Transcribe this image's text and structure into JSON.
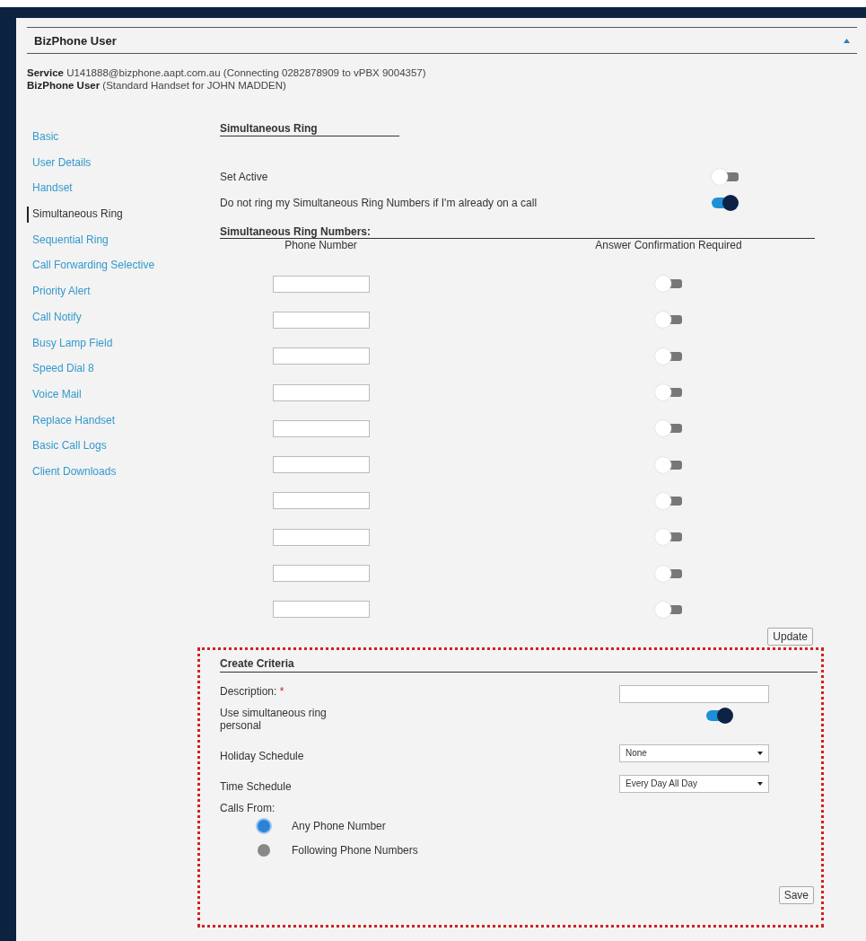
{
  "panel": {
    "title": "BizPhone User"
  },
  "info": [
    "**Service** U141888@bizphone.aapt.com.au (Connecting 0282878909 to vPBX 9004357)",
    "**BizPhone User** (Standard Handset for JOHN MADDEN)"
  ],
  "sidebar": {
    "items": [
      {
        "label": "Basic",
        "selected": false
      },
      {
        "label": "User Details",
        "selected": false
      },
      {
        "label": "Handset",
        "selected": false
      },
      {
        "label": "Simultaneous Ring",
        "selected": true
      },
      {
        "label": "Sequential Ring",
        "selected": false
      },
      {
        "label": "Call Forwarding Selective",
        "selected": false
      },
      {
        "label": "Priority Alert",
        "selected": false
      },
      {
        "label": "Call Notify",
        "selected": false
      },
      {
        "label": "Busy Lamp Field",
        "selected": false
      },
      {
        "label": "Speed Dial 8",
        "selected": false
      },
      {
        "label": "Voice Mail",
        "selected": false
      },
      {
        "label": "Replace Handset",
        "selected": false
      },
      {
        "label": "Basic Call Logs",
        "selected": false
      },
      {
        "label": "Client Downloads",
        "selected": false
      }
    ]
  },
  "section_title": "Simultaneous Ring",
  "settings": [
    {
      "label": "Set Active",
      "on": false
    },
    {
      "label": "Do not ring my Simultaneous Ring Numbers if I'm already on a call",
      "on": true
    }
  ],
  "numbers": {
    "heading": "Simultaneous Ring Numbers:",
    "columns": [
      "Phone Number",
      "Answer Confirmation Required"
    ],
    "rows": [
      {
        "answer_confirmation": false
      },
      {
        "answer_confirmation": false
      },
      {
        "answer_confirmation": false
      },
      {
        "answer_confirmation": false
      },
      {
        "answer_confirmation": false
      },
      {
        "answer_confirmation": false
      },
      {
        "answer_confirmation": false
      },
      {
        "answer_confirmation": false
      },
      {
        "answer_confirmation": false
      },
      {
        "answer_confirmation": false
      }
    ]
  },
  "update_button": "Update",
  "criteria": {
    "title": "Create Criteria",
    "fields": [
      {
        "kind": "text",
        "label": "Description:",
        "required": "*"
      },
      {
        "kind": "toggle",
        "label": "Use simultaneous ring personal",
        "on": true
      },
      {
        "kind": "select",
        "label": "Holiday Schedule",
        "value": "None"
      },
      {
        "kind": "select",
        "label": "Time Schedule",
        "value": "Every Day All Day"
      },
      {
        "kind": "radio",
        "label": "Calls From:",
        "options": [
          {
            "label": "Any Phone Number",
            "selected": true
          },
          {
            "label": "Following Phone Numbers",
            "selected": false
          }
        ]
      }
    ],
    "save_button": "Save"
  }
}
